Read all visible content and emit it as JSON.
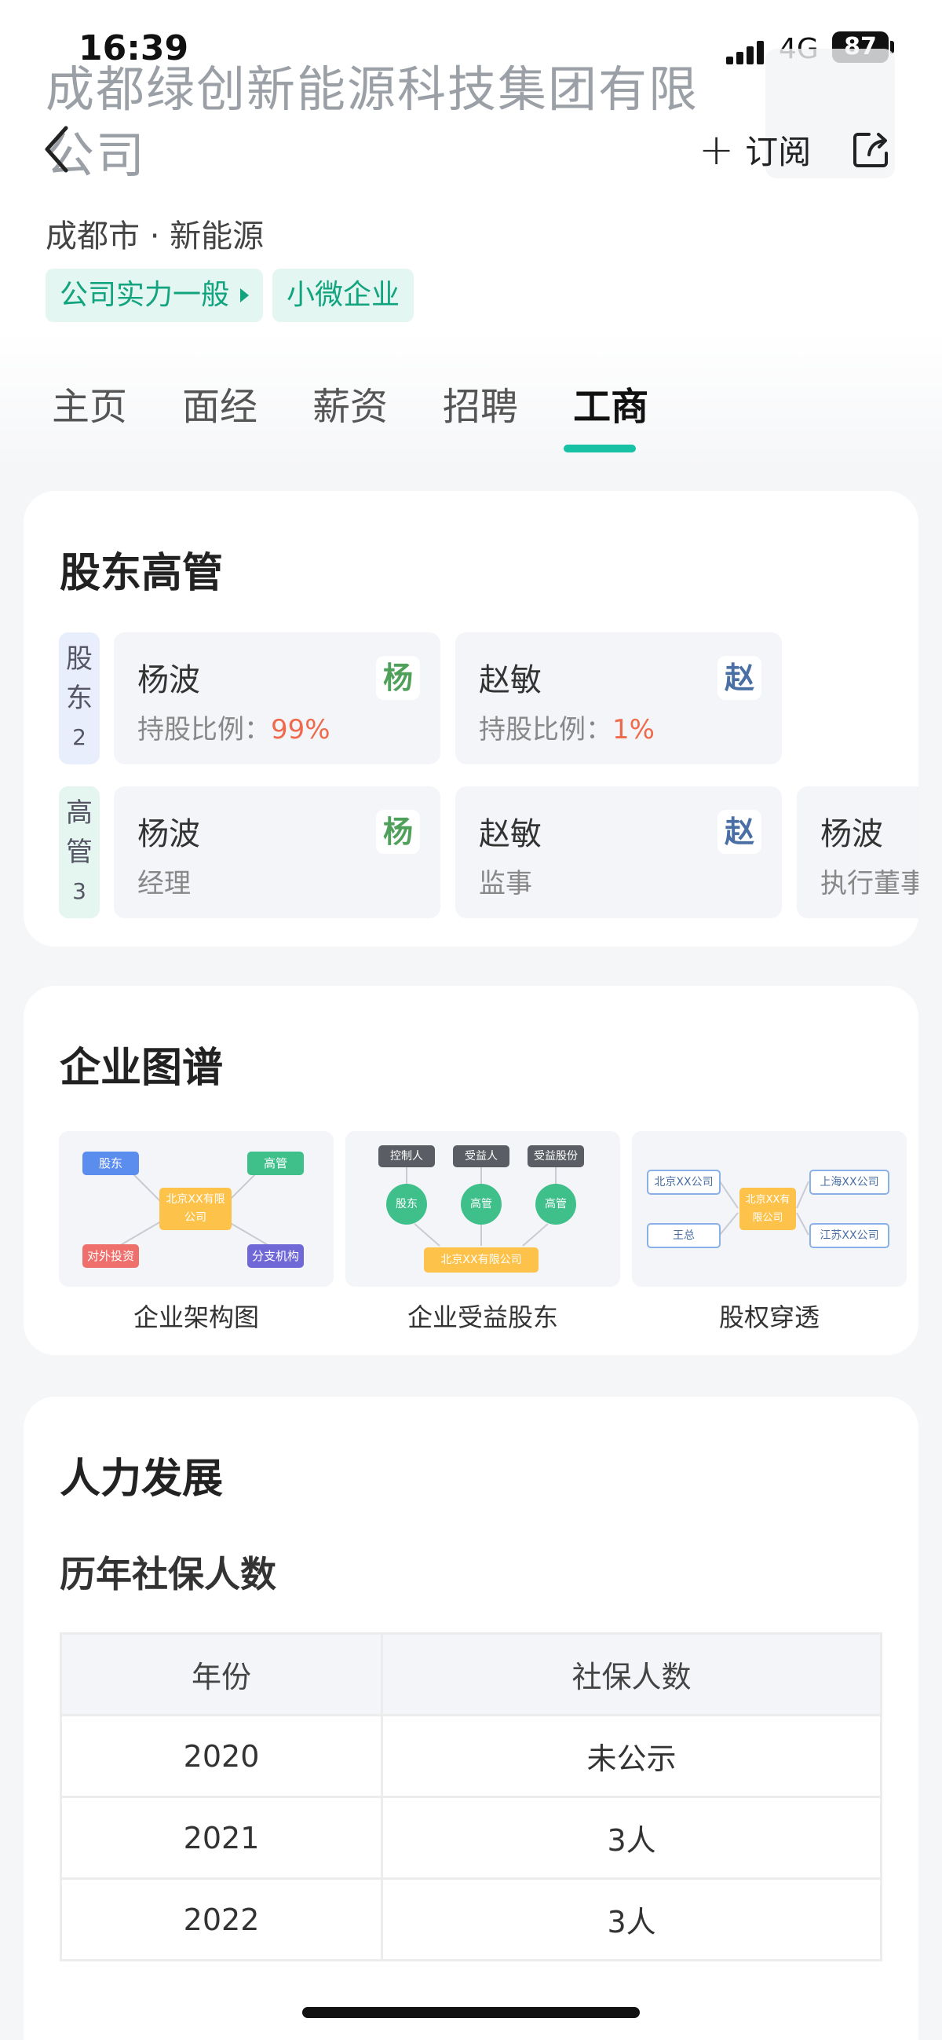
{
  "status_bar": {
    "time": "16:39",
    "network": "4G",
    "battery": "87"
  },
  "header": {
    "company_name": "成都绿创新能源科技集团有限公司",
    "subscribe_label": "订阅",
    "location": "成都市",
    "industry": "新能源",
    "tags": [
      "公司实力一般",
      "小微企业"
    ]
  },
  "tabs": [
    "主页",
    "面经",
    "薪资",
    "招聘",
    "工商"
  ],
  "active_tab": "工商",
  "shareholders_section": {
    "title": "股东高管",
    "shareholder_label": "股东",
    "shareholder_count": "2",
    "shareholders": [
      {
        "name": "杨波",
        "avatar": "杨",
        "ratio_label": "持股比例：",
        "ratio": "99%"
      },
      {
        "name": "赵敏",
        "avatar": "赵",
        "ratio_label": "持股比例：",
        "ratio": "1%"
      }
    ],
    "executive_label": "高管",
    "executive_count": "3",
    "executives": [
      {
        "name": "杨波",
        "avatar": "杨",
        "role": "经理"
      },
      {
        "name": "赵敏",
        "avatar": "赵",
        "role": "监事"
      },
      {
        "name": "杨波",
        "avatar": "",
        "role": "执行董事"
      }
    ]
  },
  "graph_section": {
    "title": "企业图谱",
    "items": [
      {
        "label": "企业架构图",
        "nodes": {
          "shareholder": "股东",
          "executive": "高管",
          "center": "北京XX有限公司",
          "investment": "对外投资",
          "branch": "分支机构"
        }
      },
      {
        "label": "企业受益股东",
        "nodes": {
          "controller": "控制人",
          "beneficiary": "受益人",
          "benefit_share": "受益股份",
          "shareholder": "股东",
          "exec1": "高管",
          "exec2": "高管",
          "company": "北京XX有限公司"
        }
      },
      {
        "label": "股权穿透",
        "nodes": {
          "left_top": "北京XX公司",
          "left_bottom": "王总",
          "center": "北京XX有限公司",
          "right_top": "上海XX公司",
          "right_bottom": "江苏XX公司"
        }
      }
    ]
  },
  "hr_section": {
    "title": "人力发展",
    "subtitle": "历年社保人数",
    "table": {
      "headers": [
        "年份",
        "社保人数"
      ],
      "rows": [
        [
          "2020",
          "未公示"
        ],
        [
          "2021",
          "3人"
        ],
        [
          "2022",
          "3人"
        ]
      ]
    }
  },
  "colors": {
    "accent": "#16c2a3",
    "tag_bg": "#e3f6f1",
    "tag_text": "#12a37f",
    "ratio": "#ef6a4c"
  }
}
